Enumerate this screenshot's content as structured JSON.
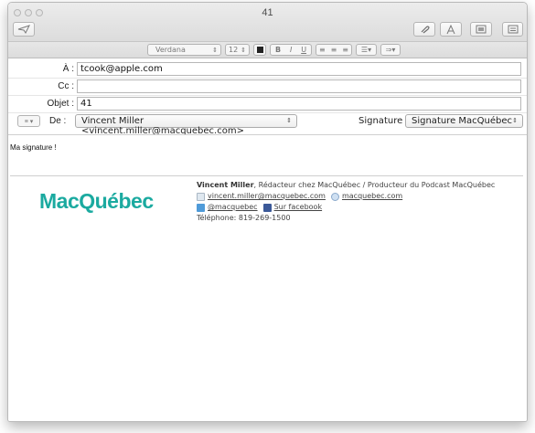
{
  "window": {
    "title": "41"
  },
  "toolbar": {
    "send": "send-icon",
    "attach": "paperclip-icon",
    "format": "format-text-icon",
    "photo": "photo-browser-icon",
    "sidebar": "stationery-icon"
  },
  "formatbar": {
    "font": "Verdana",
    "size": "12",
    "styles": [
      "B",
      "I",
      "U"
    ],
    "align_icons": [
      "align-left-icon",
      "align-center-icon",
      "align-right-icon"
    ]
  },
  "headers": {
    "to_label": "À :",
    "to_value": "tcook@apple.com",
    "cc_label": "Cc :",
    "cc_value": "",
    "subject_label": "Objet :",
    "subject_value": "41",
    "from_label": "De :",
    "from_value": "Vincent Miller <vincent.miller@macquebec.com>",
    "signature_label": "Signature :",
    "signature_value": "Signature MacQuébec"
  },
  "body": {
    "text": "Ma signature !",
    "logo": "MacQuébec",
    "sig_name": "Vincent Miller",
    "sig_role": ", Rédacteur chez MacQuébec / Producteur du Podcast MacQuébec",
    "email": "vincent.miller@macquebec.com",
    "website": "macquebec.com",
    "twitter": "@macquebec",
    "facebook": "Sur facebook",
    "phone": "Téléphone: 819-269-1500"
  },
  "colors": {
    "brand": "#1baaa0",
    "twitter": "#4f9bd9",
    "facebook": "#3b5998"
  }
}
